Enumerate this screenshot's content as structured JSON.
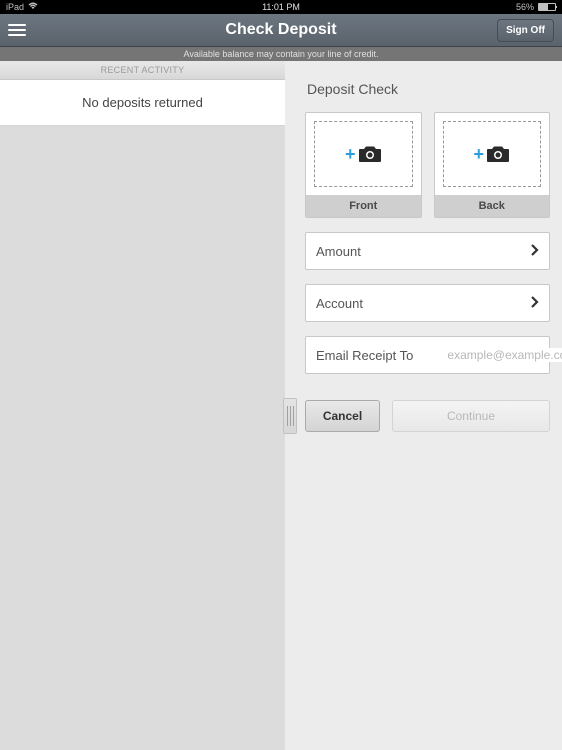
{
  "statusBar": {
    "device": "iPad",
    "time": "11:01 PM",
    "batteryPercent": "56%"
  },
  "nav": {
    "title": "Check Deposit",
    "signOff": "Sign Off"
  },
  "warningText": "Available balance may contain your line of credit.",
  "leftPane": {
    "header": "RECENT ACTIVITY",
    "emptyText": "No deposits returned"
  },
  "rightPane": {
    "title": "Deposit Check",
    "captureFront": "Front",
    "captureBack": "Back",
    "amountLabel": "Amount",
    "accountLabel": "Account",
    "emailLabel": "Email Receipt To",
    "emailPlaceholder": "example@example.com",
    "cancel": "Cancel",
    "continue": "Continue"
  }
}
